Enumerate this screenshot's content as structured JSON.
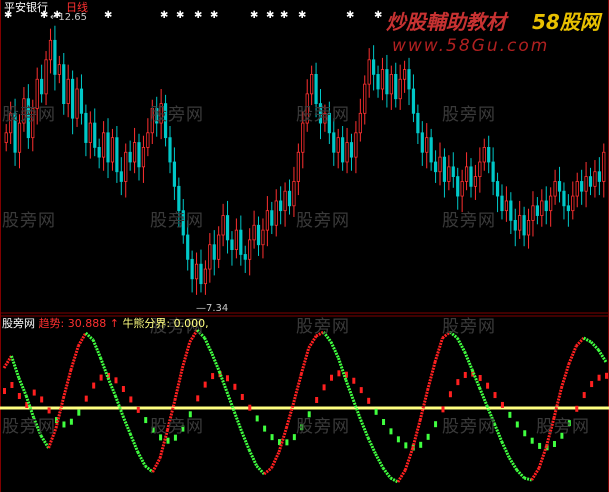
{
  "header": {
    "symbol": "平安银行",
    "period": "日线",
    "high_marker": "12.65",
    "low_marker": "7.34"
  },
  "indicator": {
    "name": "股旁网",
    "value_label": "趋势:",
    "value": "30.888",
    "arrow": "↑",
    "divider_label": "牛熊分界:",
    "divider_value": "0.000,"
  },
  "watermark": {
    "text": "股旁网",
    "brand_left": "炒股輔助教材",
    "brand_right": "58股网",
    "site": "www.58Gu.com"
  },
  "colors": {
    "up": "#ff3030",
    "down": "#00c8c8",
    "trend_up": "#ff2020",
    "trend_down": "#40ff40",
    "divider": "#ffff80",
    "frame": "#800000"
  },
  "chart_data": [
    {
      "type": "candlestick",
      "title": "平安银行 日线",
      "ylim": [
        7.0,
        13.0
      ],
      "annotations": [
        {
          "label": "12.65",
          "kind": "high"
        },
        {
          "label": "7.34",
          "kind": "low"
        }
      ],
      "close": [
        10.6,
        11.0,
        10.2,
        10.8,
        11.3,
        10.5,
        11.1,
        11.7,
        11.4,
        12.1,
        12.5,
        11.8,
        12.0,
        11.2,
        11.7,
        10.9,
        11.5,
        11.0,
        10.4,
        10.8,
        10.3,
        10.1,
        10.6,
        10.0,
        10.5,
        9.8,
        9.6,
        10.2,
        10.0,
        10.4,
        9.9,
        10.3,
        10.6,
        11.1,
        10.8,
        11.2,
        10.5,
        10.0,
        9.5,
        9.0,
        8.5,
        8.0,
        7.6,
        7.9,
        7.5,
        7.8,
        8.3,
        8.0,
        8.5,
        8.9,
        8.4,
        8.2,
        8.6,
        8.1,
        8.0,
        8.4,
        8.7,
        8.3,
        8.6,
        9.0,
        8.7,
        9.2,
        9.0,
        9.4,
        9.1,
        9.6,
        10.2,
        10.8,
        11.4,
        11.8,
        11.2,
        10.8,
        11.0,
        10.6,
        10.2,
        10.5,
        10.0,
        10.4,
        10.1,
        10.6,
        11.0,
        11.6,
        12.1,
        11.8,
        11.5,
        11.9,
        11.4,
        11.8,
        11.3,
        11.7,
        11.9,
        11.5,
        11.0,
        10.6,
        10.2,
        10.5,
        10.0,
        9.8,
        10.1,
        9.6,
        9.9,
        9.7,
        9.3,
        9.6,
        9.9,
        9.5,
        9.7,
        10.0,
        10.3,
        10.0,
        9.6,
        9.3,
        9.0,
        9.2,
        8.8,
        8.6,
        8.9,
        8.5,
        8.8,
        9.1,
        8.9,
        9.2,
        9.0,
        9.3,
        9.6,
        9.4,
        9.1,
        9.0,
        9.3,
        9.6,
        9.4,
        9.7,
        9.5,
        9.8,
        9.6,
        10.2
      ]
    },
    {
      "type": "line",
      "title": "股旁网",
      "series": [
        {
          "name": "趋势",
          "values": [
            40,
            52,
            30,
            12,
            -10,
            -28,
            -40,
            -20,
            10,
            38,
            62,
            75,
            68,
            50,
            30,
            12,
            -8,
            -26,
            -44,
            -58,
            -64,
            -50,
            -22,
            8,
            40,
            66,
            78,
            70,
            54,
            36,
            16,
            -4,
            -24,
            -42,
            -58,
            -66,
            -60,
            -44,
            -20,
            6,
            34,
            60,
            72,
            76,
            66,
            50,
            28,
            8,
            -12,
            -30,
            -46,
            -60,
            -70,
            -74,
            -62,
            -40,
            -12,
            18,
            46,
            70,
            76,
            70,
            56,
            38,
            20,
            2,
            -16,
            -34,
            -50,
            -62,
            -70,
            -72,
            -60,
            -38,
            -10,
            20,
            44,
            62,
            70,
            66,
            58,
            46
          ]
        },
        {
          "name": "牛熊分界",
          "values": [
            0
          ]
        }
      ]
    }
  ]
}
